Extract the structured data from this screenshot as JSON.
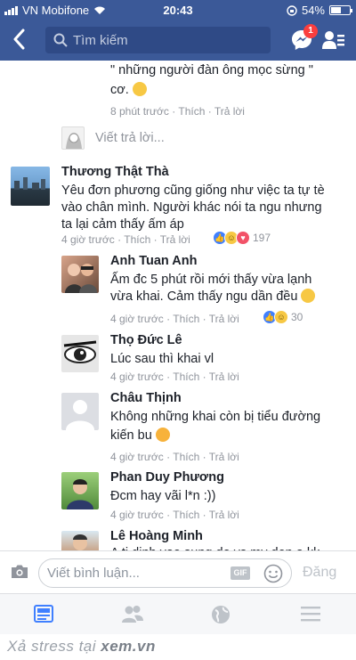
{
  "status_bar": {
    "carrier": "VN Mobifone",
    "time": "20:43",
    "battery": "54%",
    "battery_level": 0.54
  },
  "navbar": {
    "search_placeholder": "Tìm kiếm",
    "messenger_badge": "1"
  },
  "prev_reply": {
    "text_line1": "\" những người đàn ông mọc sừng \"",
    "text_line2": "cơ.",
    "time": "8 phút trước",
    "like": "Thích",
    "reply": "Trả lời"
  },
  "reply_prompt": "Viết trả lời...",
  "main_comment": {
    "author": "Thương Thật Thà",
    "text_lines": [
      "Yêu đơn phương cũng giống như việc ta tự tè",
      "vào chân mình. Người khác nói ta ngu nhưng",
      "ta lại cảm thấy ấm áp"
    ],
    "time": "4 giờ trước",
    "like": "Thích",
    "reply": "Trả lời",
    "reaction_count": "197"
  },
  "replies": [
    {
      "author": "Anh Tuan Anh",
      "text_lines": [
        "Ấm đc 5 phút rồi mới thấy vừa lạnh",
        "vừa khai. Cảm thấy ngu dần đều"
      ],
      "time": "4 giờ trước",
      "like": "Thích",
      "reply": "Trả lời",
      "reaction_count": "30"
    },
    {
      "author": "Thọ Đức Lê",
      "text_lines": [
        "Lúc sau thì khai vl"
      ],
      "time": "4 giờ trước",
      "like": "Thích",
      "reply": "Trả lời"
    },
    {
      "author": "Châu Thịnh",
      "text_lines": [
        "Không những khai còn bị tiểu đường",
        "kiến bu"
      ],
      "time": "4 giờ trước",
      "like": "Thích",
      "reply": "Trả lời"
    },
    {
      "author": "Phan Duy Phương",
      "text_lines": [
        "Đcm hay vãi l*n :))"
      ],
      "time": "4 giờ trước",
      "like": "Thích",
      "reply": "Trả lời"
    },
    {
      "author": "Lê Hoàng Minh",
      "text_lines": [
        "A ti dinh vao sung do vs my den a kk"
      ]
    }
  ],
  "composer": {
    "placeholder": "Viết bình luận...",
    "gif": "GIF",
    "post_label": "Đăng"
  },
  "watermark": {
    "prefix": "Xả stress tại ",
    "site": "xem.vn"
  },
  "colors": {
    "brand": "#3b5998",
    "link_blue": "#4080ff"
  }
}
